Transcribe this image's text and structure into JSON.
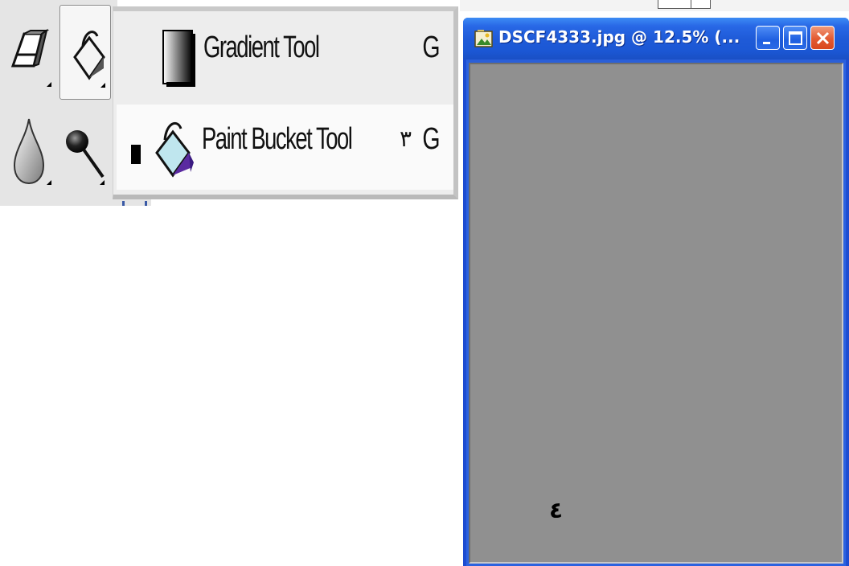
{
  "toolbox": {
    "tools": [
      {
        "name": "Eraser",
        "icon": "eraser-icon"
      },
      {
        "name": "Paint Bucket",
        "icon": "paint-bucket-icon",
        "selected": true
      },
      {
        "name": "Blur",
        "icon": "blur-drop-icon"
      },
      {
        "name": "Burn",
        "icon": "burn-tool-icon"
      }
    ]
  },
  "flyout": {
    "items": [
      {
        "label": "Gradient Tool",
        "shortcut": "G",
        "icon": "gradient-icon"
      },
      {
        "label": "Paint Bucket Tool",
        "shortcut": "G",
        "icon": "paint-bucket-icon",
        "annotation": "٣",
        "current": true
      }
    ]
  },
  "document": {
    "title": "DSCF4333.jpg @ 12.5% (...",
    "canvas_color": "#909090",
    "annotation": "٤",
    "buttons": [
      "minimize",
      "maximize",
      "close"
    ]
  },
  "colors": {
    "titlebar": "#1f5bd8",
    "close_button": "#e25a32",
    "toolbox_bg": "#e5e5e5"
  }
}
